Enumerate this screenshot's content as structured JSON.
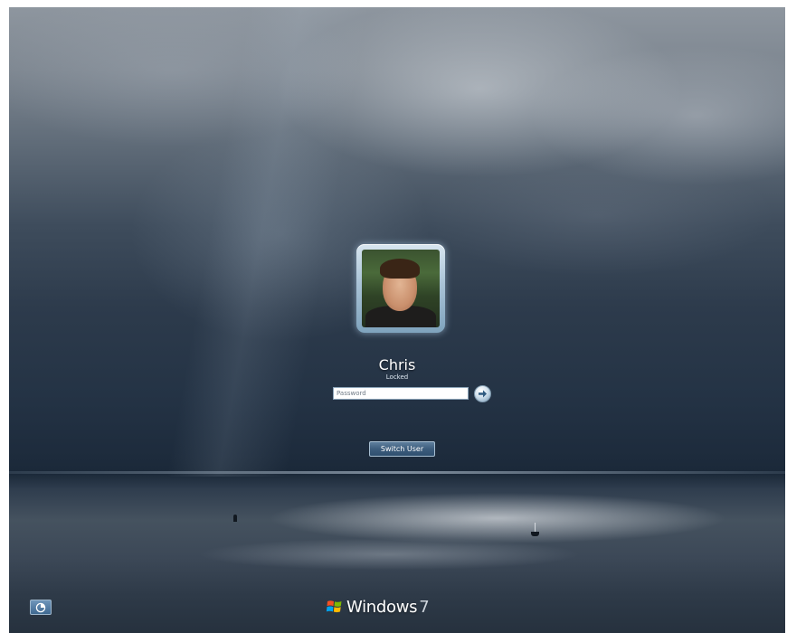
{
  "lock_screen": {
    "user": {
      "name": "Chris",
      "status": "Locked"
    },
    "password": {
      "placeholder": "Password",
      "value": ""
    },
    "submit_icon": "arrow-right-icon",
    "switch_user_label": "Switch User",
    "ease_of_access_icon": "ease-of-access-icon"
  },
  "branding": {
    "logo_icon": "windows-flag-icon",
    "product": "Windows",
    "version": "7"
  },
  "colors": {
    "accent": "#3d5d7d",
    "tile_frame": "#a9c3d6",
    "text": "#ffffff"
  }
}
